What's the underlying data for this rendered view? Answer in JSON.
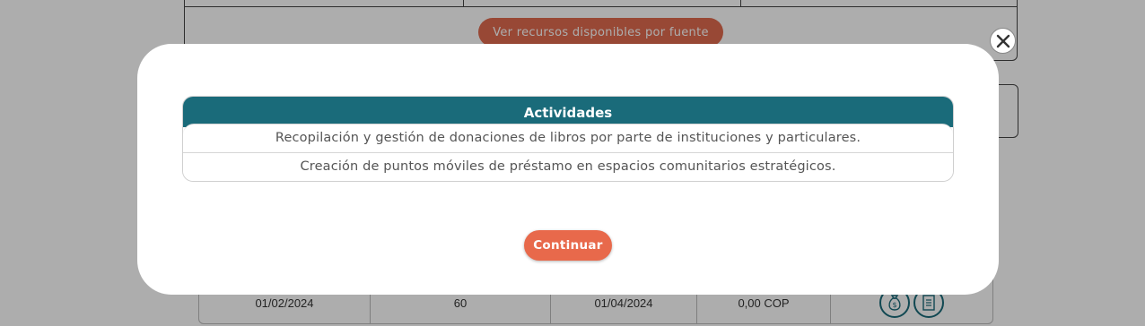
{
  "background": {
    "sources_button_label": "Ver recursos disponibles por fuente",
    "row": {
      "start_date": "01/02/2024",
      "duration": "60",
      "end_date": "01/04/2024",
      "amount": "0,00 COP"
    },
    "row_icons": [
      "money-bag-icon",
      "checklist-icon"
    ]
  },
  "modal": {
    "table_header": "Actividades",
    "activities": [
      "Recopilación y gestión de donaciones de libros por parte de instituciones y particulares.",
      "Creación de puntos móviles de préstamo en espacios comunitarios estratégicos."
    ],
    "continue_label": "Continuar",
    "close_icon": "close-icon"
  },
  "colors": {
    "primary_teal": "#1a6b7a",
    "accent_orange": "#e8694b"
  }
}
